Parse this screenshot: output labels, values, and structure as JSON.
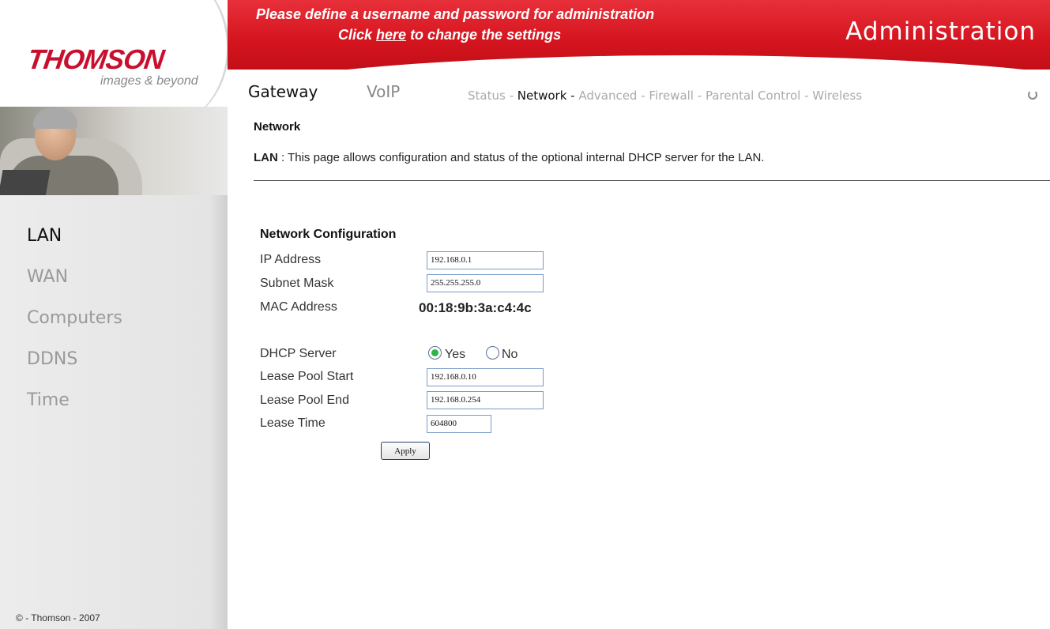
{
  "brand": {
    "logo": "THOMSON",
    "tagline": "images & beyond"
  },
  "banner": {
    "line1": "Please define a username and password for administration",
    "line2_prefix": "Click ",
    "line2_link": "here",
    "line2_suffix": " to change the settings",
    "title": "Administration",
    "color": "#d4141e"
  },
  "top_nav": {
    "gateway": "Gateway",
    "voip": "VoIP"
  },
  "sub_nav": {
    "items": [
      "Status",
      "Network",
      "Advanced",
      "Firewall",
      "Parental Control",
      "Wireless"
    ],
    "separator": " - ",
    "active": "Network"
  },
  "sidebar": {
    "items": [
      "LAN",
      "WAN",
      "Computers",
      "DDNS",
      "Time"
    ],
    "active": "LAN"
  },
  "page": {
    "title": "Network",
    "desc_label": "LAN",
    "desc_text": " :  This page allows configuration and status of the optional internal DHCP server for the LAN."
  },
  "form": {
    "section_title": "Network Configuration",
    "ip_label": "IP Address",
    "ip_value": "192.168.0.1",
    "subnet_label": "Subnet Mask",
    "subnet_value": "255.255.255.0",
    "mac_label": "MAC Address",
    "mac_value": "00:18:9b:3a:c4:4c",
    "dhcp_label": "DHCP Server",
    "dhcp_yes": "Yes",
    "dhcp_no": "No",
    "dhcp_selected": "Yes",
    "pool_start_label": "Lease Pool Start",
    "pool_start_value": "192.168.0.10",
    "pool_end_label": "Lease Pool End",
    "pool_end_value": "192.168.0.254",
    "lease_time_label": "Lease Time",
    "lease_time_value": "604800",
    "apply_label": "Apply"
  },
  "footer": {
    "copyright": "© - Thomson - 2007"
  }
}
